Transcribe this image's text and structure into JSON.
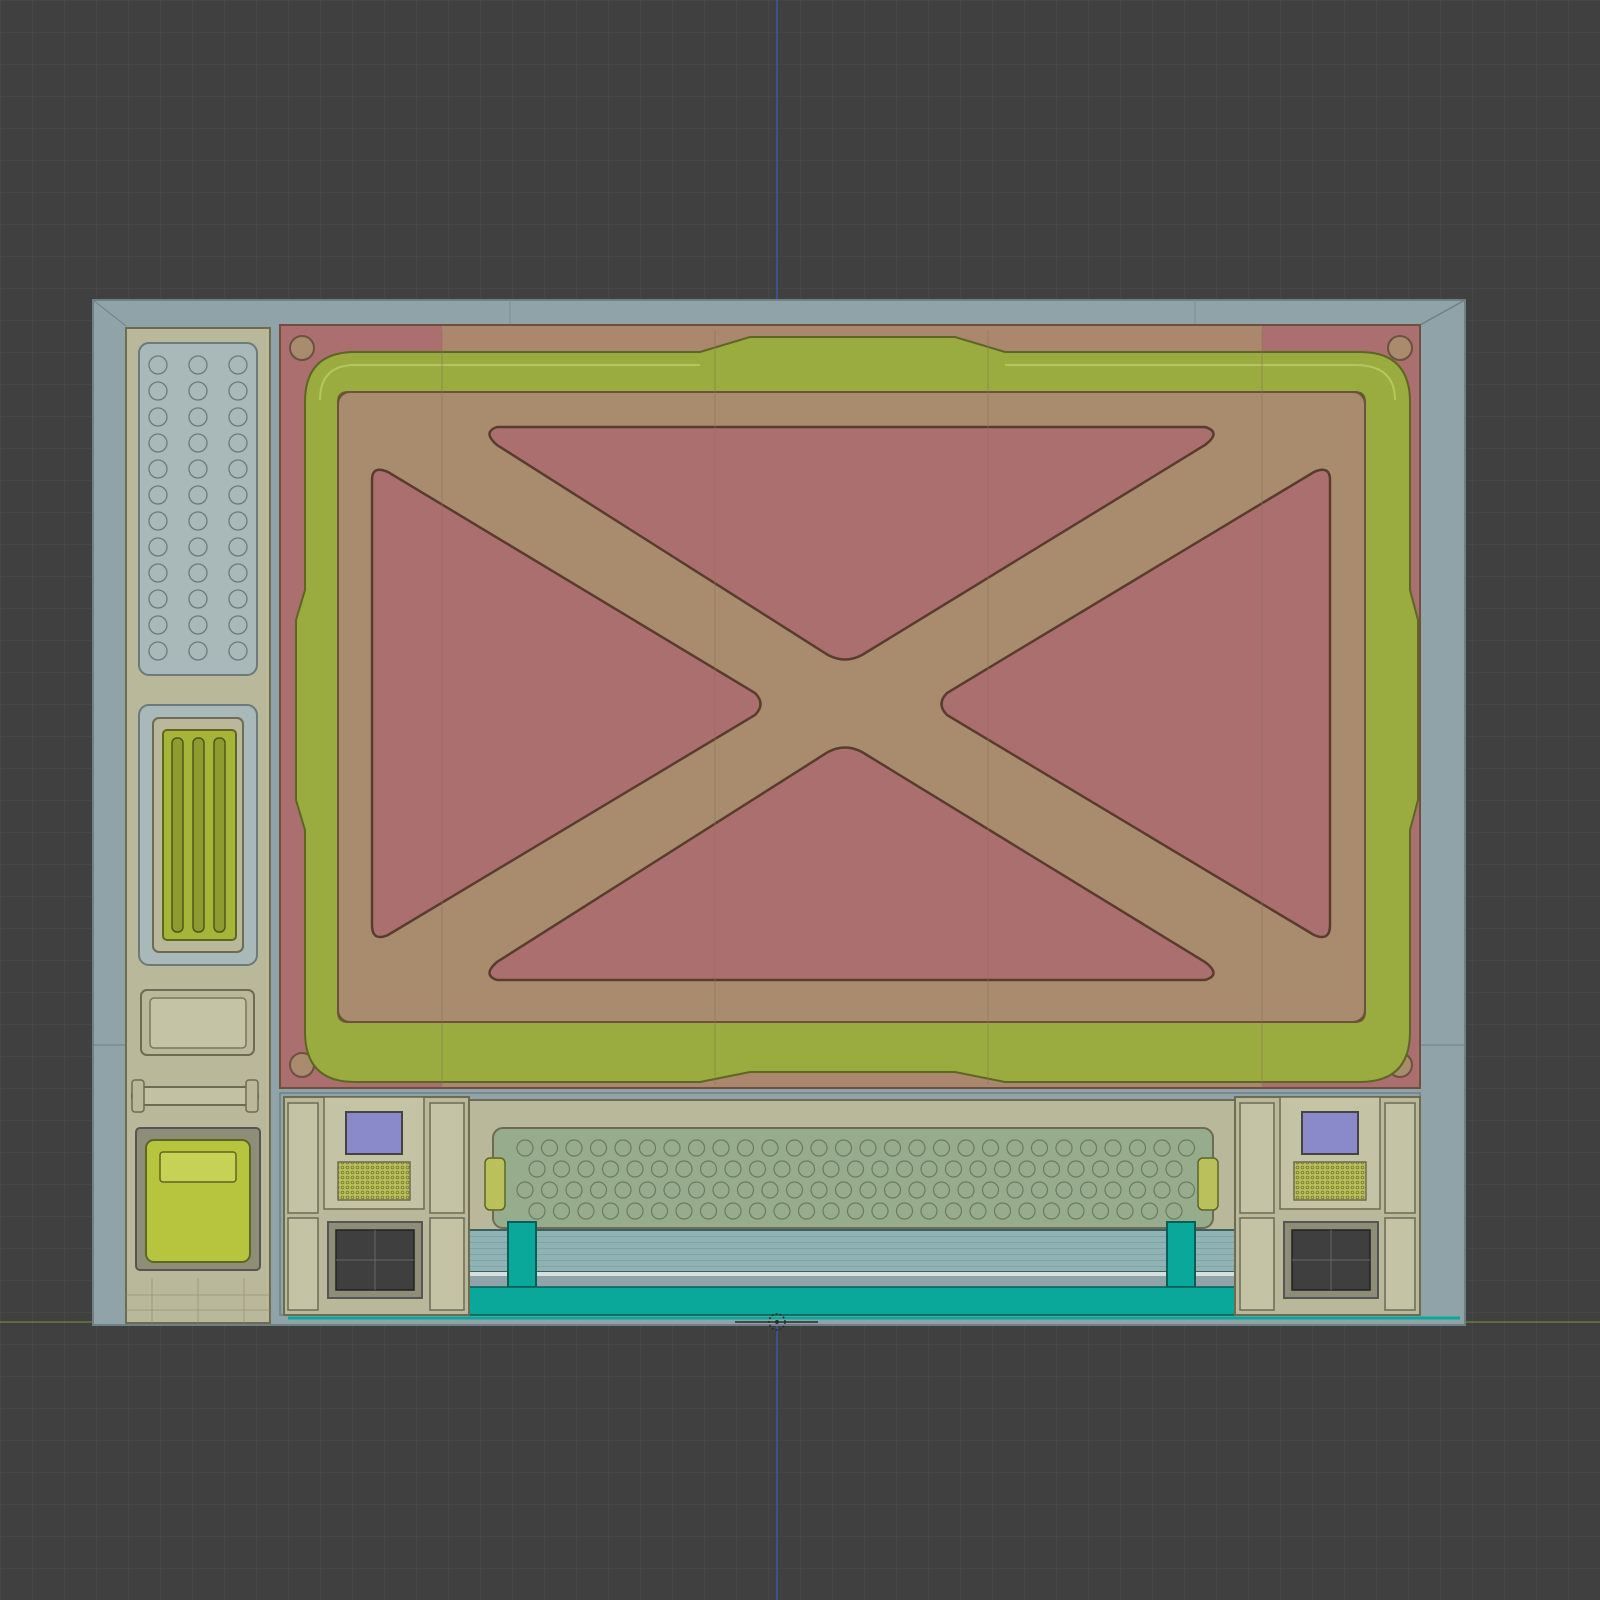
{
  "viewport": {
    "background": "#404040",
    "grid_color": "#4b4b4b",
    "axis_colors": {
      "vertical": "#3a56a8",
      "horizontal": "#7d9a3a"
    }
  },
  "model": {
    "frame_color": "#8fa3a8",
    "panel_fill": "#ab6f6f",
    "cross_fill": "#a98c6d",
    "track_fill": "#9aab3f",
    "module_fill": "#b9b89a",
    "grille_fill": "#96ac8c",
    "accent_cyan": "#09a89a",
    "screen_blue": "#8a8acb",
    "yellow_button": "#b7c43e"
  },
  "icons": {
    "origin": "origin-marker-icon"
  }
}
